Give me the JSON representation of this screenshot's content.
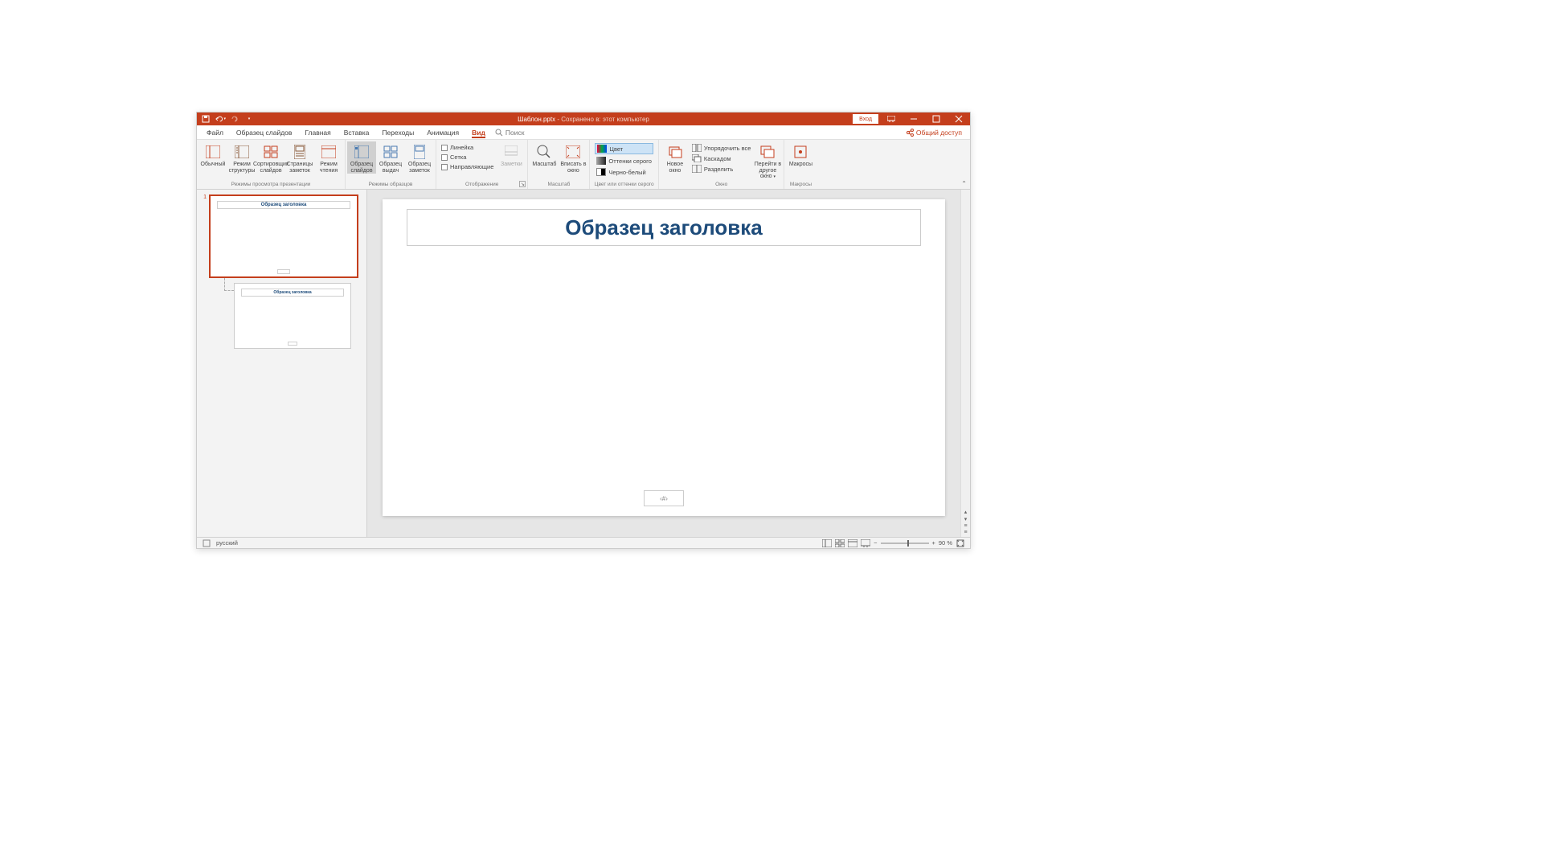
{
  "title_bar": {
    "filename": "Шаблон.pptx",
    "saved_to": " - Сохранено в: этот компьютер",
    "login": "Вход"
  },
  "tabs": {
    "file": "Файл",
    "slide_master": "Образец слайдов",
    "home": "Главная",
    "insert": "Вставка",
    "transitions": "Переходы",
    "animation": "Анимация",
    "view": "Вид",
    "search_placeholder": "Поиск",
    "share": "Общий доступ"
  },
  "ribbon": {
    "views": {
      "normal": "Обычный",
      "outline": "Режим структуры",
      "sorter": "Сортировщик слайдов",
      "notes_page": "Страницы заметок",
      "reading": "Режим чтения",
      "group_label": "Режимы просмотра презентации"
    },
    "master_views": {
      "slide_master": "Образец слайдов",
      "handout_master": "Образец выдач",
      "notes_master": "Образец заметок",
      "group_label": "Режимы образцов"
    },
    "show": {
      "ruler": "Линейка",
      "grid": "Сетка",
      "guides": "Направляющие",
      "notes": "Заметки",
      "group_label": "Отображение"
    },
    "zoom": {
      "zoom": "Масштаб",
      "fit": "Вписать в окно",
      "group_label": "Масштаб"
    },
    "color": {
      "color": "Цвет",
      "grayscale": "Оттенки серого",
      "bw": "Черно-белый",
      "group_label": "Цвет или оттенки серого"
    },
    "window": {
      "new_window": "Новое окно",
      "arrange_all": "Упорядочить все",
      "cascade": "Каскадом",
      "split": "Разделить",
      "switch": "Перейти в другое окно",
      "group_label": "Окно"
    },
    "macros": {
      "macros": "Макросы",
      "group_label": "Макросы"
    }
  },
  "thumbnails": {
    "num1": "1",
    "master_title": "Образец заголовка",
    "layout_title": "Образец заголовка"
  },
  "slide": {
    "title_placeholder": "Образец заголовка",
    "page_num_placeholder": "‹#›"
  },
  "status": {
    "language": "русский",
    "zoom_value": "90 %"
  }
}
